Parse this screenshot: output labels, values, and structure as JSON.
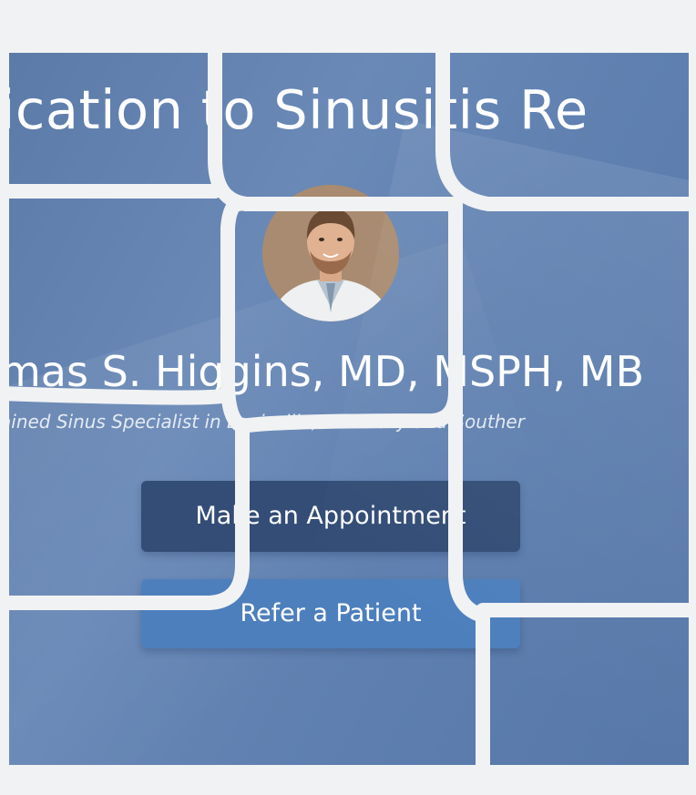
{
  "hero": {
    "headline": "ication to Sinusitis Re",
    "doctor_name": "mas S. Higgins, MD, MSPH, MB",
    "tagline": "ained Sinus Specialist in Louisville, Kentucky and Souther",
    "avatar_alt": "Doctor portrait"
  },
  "actions": {
    "appointment_label": "Make an Appointment",
    "refer_label": "Refer a Patient"
  },
  "colors": {
    "hero_background": "#6384b2",
    "appointment_button": "#334d76",
    "refer_button": "#4d7fbd",
    "tile_gutter": "#f1f2f3"
  }
}
